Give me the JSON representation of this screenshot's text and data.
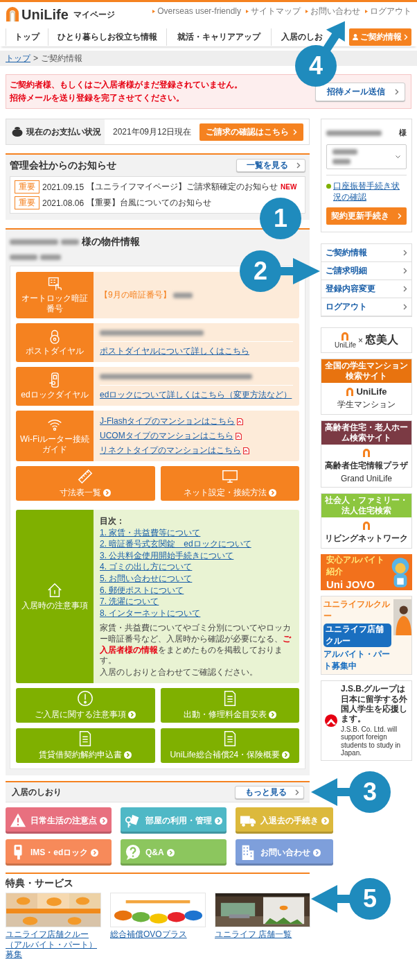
{
  "header": {
    "logo": "UniLife",
    "logo_sub": "マイページ",
    "top_links": [
      "Overseas user-friendly",
      "サイトマップ",
      "お問い合わせ",
      "ログアウト"
    ],
    "nav": [
      "トップ",
      "ひとり暮らしお役立ち情報",
      "就活・キャリアアップ",
      "入居のしお"
    ],
    "contract_button": "ご契約情報"
  },
  "breadcrumb": {
    "items": [
      "トップ",
      "ご契約情報"
    ],
    "separator": ">"
  },
  "alert": {
    "lines": [
      "ご契約者様、もしくはご入居者様がまだ登録されていません。",
      "招待メールを送り登録を完了させてください。"
    ],
    "button": "招待メール送信"
  },
  "payment": {
    "label": "現在のお支払い状況",
    "date": "2021年09月12日現在",
    "button": "ご請求の確認はこちら"
  },
  "notices": {
    "title": "管理会社からのお知らせ",
    "more": "一覧を見る",
    "items": [
      {
        "tag": "重要",
        "date": "2021.09.15",
        "text": "【ユニライフマイページ】ご請求額確定のお知らせ",
        "badge": "NEW"
      },
      {
        "tag": "重要",
        "date": "2021.08.06",
        "text": "【重要】台風についてのお知らせ"
      }
    ]
  },
  "property": {
    "title": "様の物件情報",
    "info": [
      {
        "kind": "autolock",
        "label": "オートロック暗証番号",
        "heading": "【9月の暗証番号】"
      },
      {
        "kind": "post",
        "label": "ポストダイヤル",
        "links": [
          "ポストダイヤルについて詳しくはこちら"
        ]
      },
      {
        "kind": "edlock",
        "label": "edロックダイヤル",
        "links": [
          "edロックについて詳しくはこちら（変更方法など）"
        ]
      },
      {
        "kind": "wifi",
        "label": "Wi-Fiルーター接続ガイド",
        "pdf": true,
        "links": [
          "J-Flashタイプのマンションはこちら",
          "UCOMタイプのマンションはこちら",
          "リネクトタイプのマンションはこちら"
        ]
      }
    ],
    "tiles": [
      {
        "label": "寸法表一覧"
      },
      {
        "label": "ネット設定・接続方法"
      }
    ],
    "notes": {
      "label": "入居時の注意事項",
      "toc_title": "目次：",
      "toc": [
        "1. 家賃・共益費等について",
        "2. 暗証番号式玄関錠　edロックについて",
        "3. 公共料金使用開始手続きについて",
        "4. ゴミの出し方について",
        "5. お問い合わせについて",
        "6. 郵便ポストについて",
        "7. 洗濯について",
        "8. インターネットについて"
      ],
      "body": [
        "家賃・共益費についてやゴミ分別についてやロッカー暗証番号など、入居時から確認が必要になる、**ご入居者様の情報**をまとめたものを掲載しております。",
        "入居のしおりと合わせてご確認ください。"
      ]
    },
    "green_tiles": [
      {
        "label": "ご入居に関する注意事項"
      },
      {
        "label": "出動・修理料金目安表"
      },
      {
        "label": "賃貸借契約解約申込書"
      },
      {
        "label": "UniLife総合補償24・保険概要"
      }
    ]
  },
  "guide": {
    "title": "入居のしおり",
    "more": "もっと見る",
    "items": [
      {
        "label": "日常生活の注意点",
        "color": "#e8707f"
      },
      {
        "label": "部屋の利用・管理",
        "color": "#4fb8c6"
      },
      {
        "label": "入退去の手続き",
        "color": "#dcb93c"
      },
      {
        "label": "IMS・edロック",
        "color": "#f78a5a"
      },
      {
        "label": "Q&A",
        "color": "#8cc65e"
      },
      {
        "label": "お問い合わせ",
        "color": "#7e9fdb"
      }
    ]
  },
  "services": {
    "title": "特典・サービス",
    "items": [
      {
        "label": "ユニライフ店舗クルー（アルバイト・パート）募集"
      },
      {
        "label": "総合補償OVOプラス"
      },
      {
        "label": "ユニライフ 店舗一覧"
      }
    ]
  },
  "sidebar": {
    "honorific": "様",
    "link": "口座振替手続き状況の確認",
    "renew": "契約更新手続き",
    "menu": [
      "ご契約情報",
      "ご請求明細",
      "登録内容変更",
      "ログアウト"
    ],
    "banners": [
      {
        "kind": "collab",
        "logo": "UniLife",
        "mark": "×",
        "title": "窓美人"
      },
      {
        "kind": "site",
        "header": "全国の学生マンション検索サイト",
        "color": "#e8730f",
        "logo": "UniLife",
        "sub": "学生マンション"
      },
      {
        "kind": "site",
        "header": "高齢者住宅・老人ホーム検索サイト",
        "color": "#7b3a44",
        "logo": "高齢者住宅情報プラザ",
        "sub": "Grand UniLife"
      },
      {
        "kind": "site",
        "header": "社会人・ファミリー・法人住宅検索",
        "color": "#8cc63f",
        "logo": "リビングネットワーク"
      },
      {
        "kind": "jovo",
        "tagline": "安心アルバイト紹介",
        "title": "Uni JOVO"
      },
      {
        "kind": "crew",
        "title": "ユニライフルクルー",
        "badge": "ユニライフ店舗クルー",
        "headline": "アルバイト・パート募集中"
      },
      {
        "kind": "jsb",
        "text": "J.S.B.グループは日本に留学する外国人学生を応援します。",
        "english": "J.S.B. Co. Ltd. will support foreign students to study in Japan."
      }
    ]
  },
  "callouts": [
    {
      "number": "4"
    },
    {
      "number": "1"
    },
    {
      "number": "2"
    },
    {
      "number": "3"
    },
    {
      "number": "5"
    }
  ]
}
